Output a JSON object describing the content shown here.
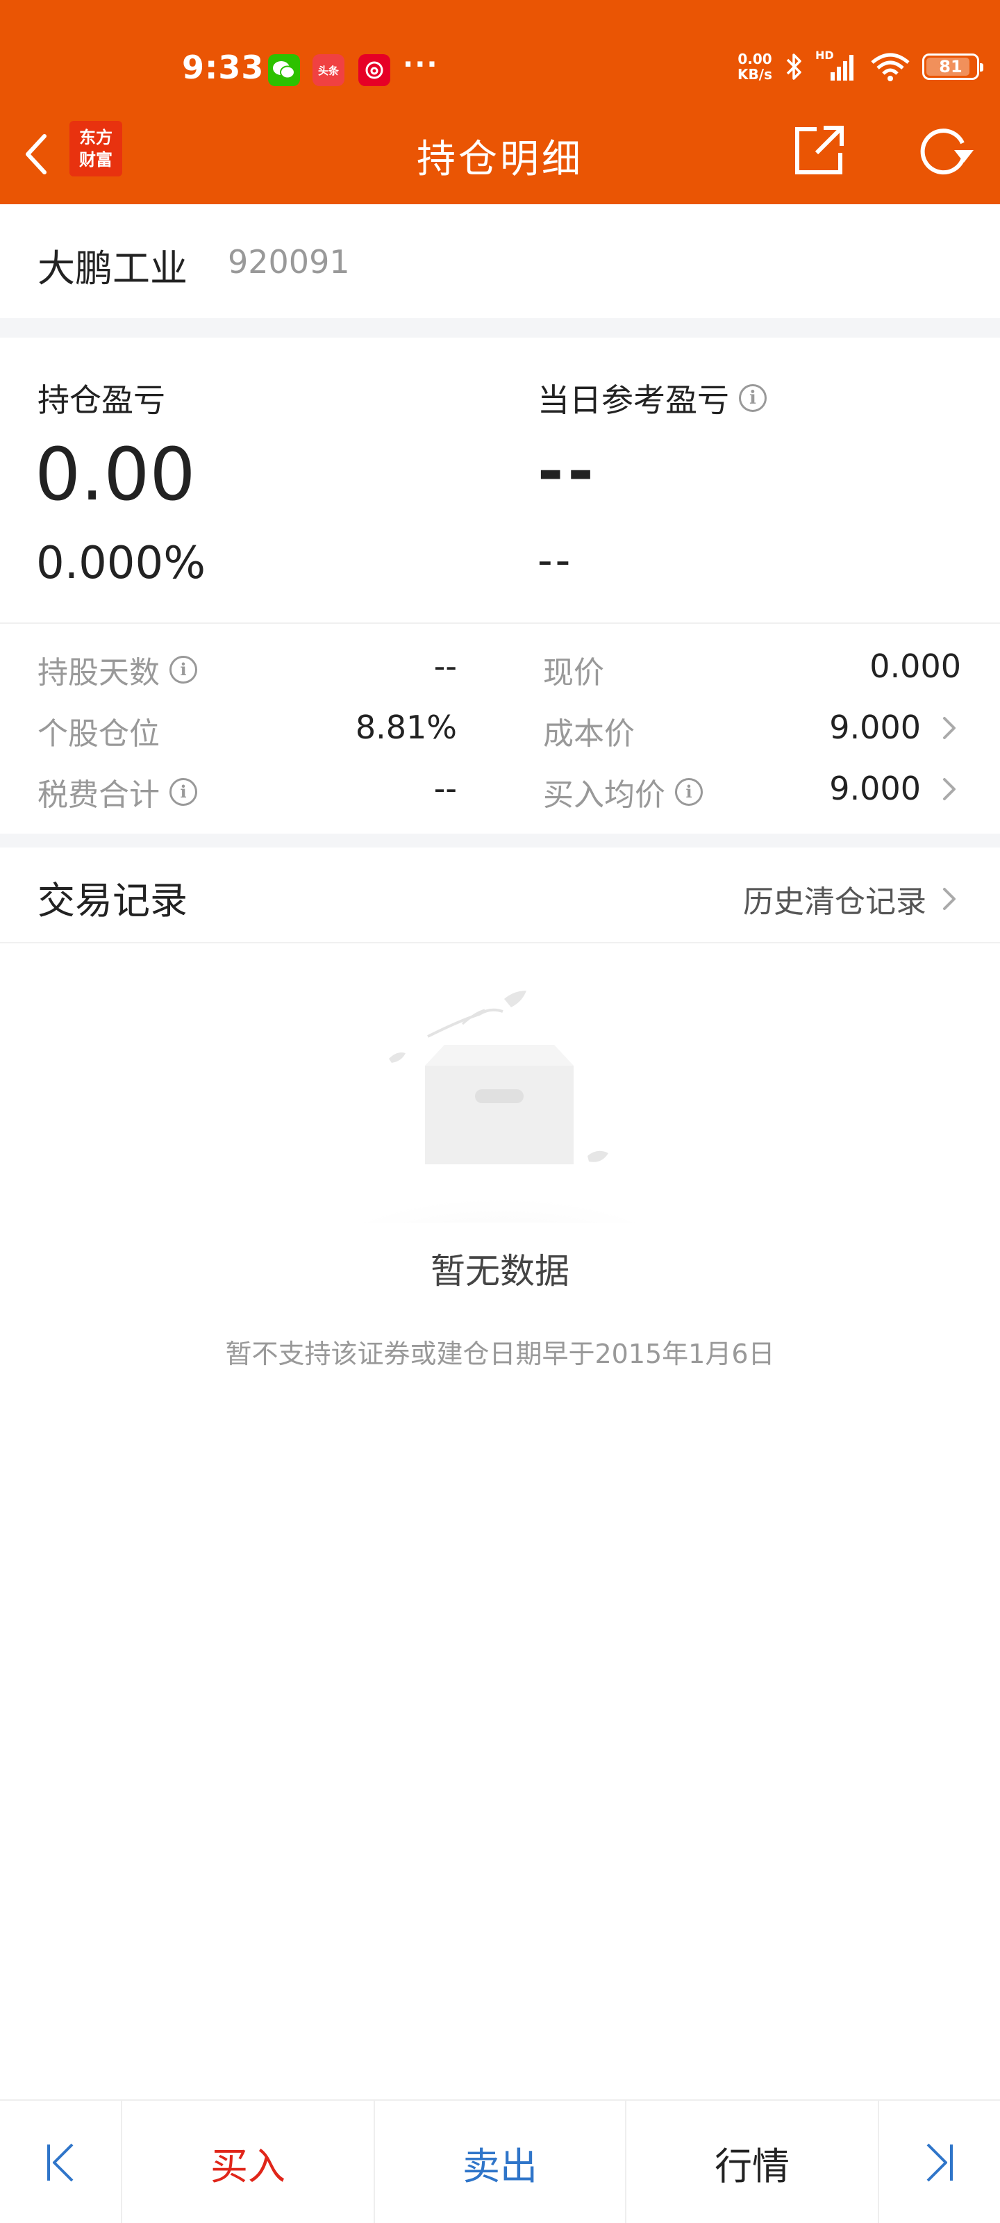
{
  "status_bar": {
    "time": "9:33",
    "toutiao_label": "头条",
    "network_speed_value": "0.00",
    "network_speed_unit": "KB/s",
    "hd_label": "HD",
    "battery_level": "81",
    "notifications": [
      "wechat-icon",
      "toutiao-icon",
      "netease-music-icon"
    ]
  },
  "nav": {
    "logo_line1": "东方",
    "logo_line2": "财富",
    "title": "持仓明细"
  },
  "stock": {
    "name": "大鹏工业",
    "code": "920091"
  },
  "profit": {
    "position_label": "持仓盈亏",
    "position_value": "0.00",
    "position_pct": "0.000%",
    "daily_label": "当日参考盈亏",
    "daily_value": "--",
    "daily_pct": "--"
  },
  "metrics": {
    "left": [
      {
        "label": "持股天数",
        "value": "--",
        "info": true
      },
      {
        "label": "个股仓位",
        "value": "8.81%",
        "info": false
      },
      {
        "label": "税费合计",
        "value": "--",
        "info": true
      }
    ],
    "right": [
      {
        "label": "现价",
        "value": "0.000",
        "info": false,
        "chevron": false
      },
      {
        "label": "成本价",
        "value": "9.000",
        "info": false,
        "chevron": true
      },
      {
        "label": "买入均价",
        "value": "9.000",
        "info": true,
        "chevron": true
      }
    ]
  },
  "trades": {
    "title": "交易记录",
    "history_link": "历史清仓记录",
    "empty_title": "暂无数据",
    "empty_subtitle": "暂不支持该证券或建仓日期早于2015年1月6日"
  },
  "bottom_bar": {
    "buy": "买入",
    "sell": "卖出",
    "quote": "行情"
  },
  "colors": {
    "brand": "#ea5504",
    "buy": "#e0261a",
    "sell": "#2f75c9"
  }
}
